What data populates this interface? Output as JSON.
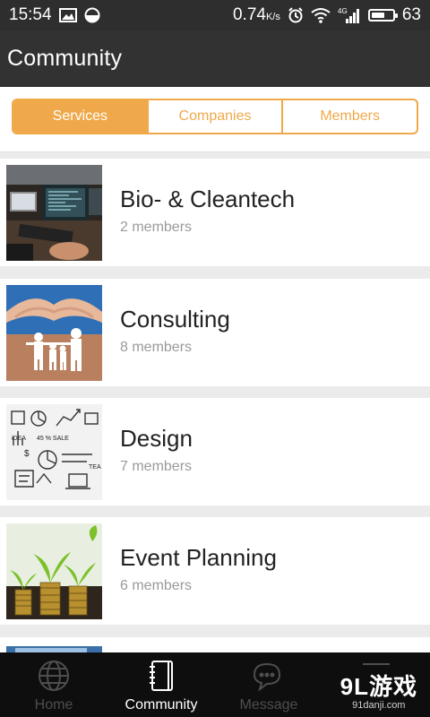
{
  "status_bar": {
    "time": "15:54",
    "data_speed": "0.74",
    "data_unit": "K/s",
    "network": "4G",
    "battery": "63",
    "battery_level": 0.63
  },
  "app_bar": {
    "title": "Community"
  },
  "tabs": [
    {
      "label": "Services",
      "active": true
    },
    {
      "label": "Companies",
      "active": false
    },
    {
      "label": "Members",
      "active": false
    }
  ],
  "services": [
    {
      "title": "Bio- & Cleantech",
      "members": "2 members",
      "thumb": "computer-screens-photo"
    },
    {
      "title": "Consulting",
      "members": "8 members",
      "thumb": "family-paper-cutout-photo"
    },
    {
      "title": "Design",
      "members": "7 members",
      "thumb": "business-sketch-photo"
    },
    {
      "title": "Event Planning",
      "members": "6 members",
      "thumb": "coins-plants-photo"
    }
  ],
  "bottom_nav": [
    {
      "label": "Home",
      "icon": "globe-icon",
      "active": false
    },
    {
      "label": "Community",
      "icon": "notebook-icon",
      "active": true
    },
    {
      "label": "Message",
      "icon": "chat-icon",
      "active": false
    }
  ],
  "watermark": {
    "main": "9L游戏",
    "sub": "91danji.com"
  },
  "colors": {
    "accent": "#f0a94a",
    "appbar": "#323232",
    "nav_bg": "#0e0e0e"
  }
}
